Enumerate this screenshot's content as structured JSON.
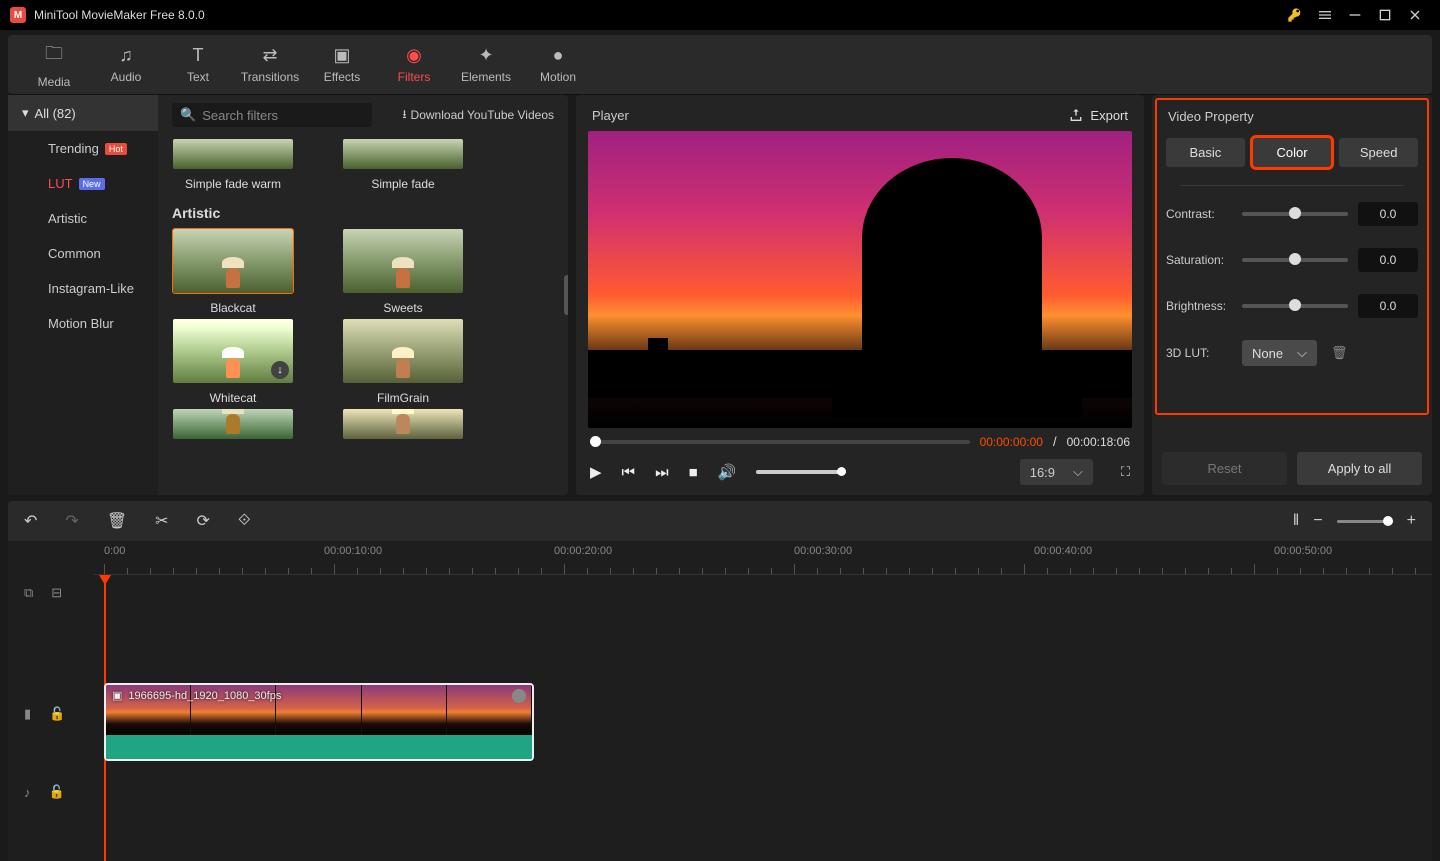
{
  "app": {
    "title": "MiniTool MovieMaker Free 8.0.0"
  },
  "toolbar": {
    "tabs": [
      {
        "label": "Media"
      },
      {
        "label": "Audio"
      },
      {
        "label": "Text"
      },
      {
        "label": "Transitions"
      },
      {
        "label": "Effects"
      },
      {
        "label": "Filters"
      },
      {
        "label": "Elements"
      },
      {
        "label": "Motion"
      }
    ]
  },
  "sidebar": {
    "all_label": "All (82)",
    "categories": [
      {
        "label": "Trending",
        "badge": "Hot"
      },
      {
        "label": "LUT",
        "badge": "New",
        "active": true
      },
      {
        "label": "Artistic"
      },
      {
        "label": "Common"
      },
      {
        "label": "Instagram-Like"
      },
      {
        "label": "Motion Blur"
      }
    ]
  },
  "filters": {
    "search_placeholder": "Search filters",
    "download_link": "Download YouTube Videos",
    "row0": [
      "Simple fade warm",
      "Simple fade"
    ],
    "section": "Artistic",
    "row1": [
      "Blackcat",
      "Sweets"
    ],
    "row2": [
      "Whitecat",
      "FilmGrain"
    ]
  },
  "player": {
    "title": "Player",
    "export": "Export",
    "time_current": "00:00:00:00",
    "time_total": "00:00:18:06",
    "aspect": "16:9"
  },
  "property": {
    "title": "Video Property",
    "tabs": [
      "Basic",
      "Color",
      "Speed"
    ],
    "contrast_label": "Contrast:",
    "saturation_label": "Saturation:",
    "brightness_label": "Brightness:",
    "lut_label": "3D LUT:",
    "lut_value": "None",
    "contrast": "0.0",
    "saturation": "0.0",
    "brightness": "0.0",
    "reset": "Reset",
    "apply": "Apply to all"
  },
  "timeline": {
    "ticks": [
      "0:00",
      "00:00:10:00",
      "00:00:20:00",
      "00:00:30:00",
      "00:00:40:00",
      "00:00:50:00"
    ],
    "clip_name": "1966695-hd_1920_1080_30fps"
  }
}
